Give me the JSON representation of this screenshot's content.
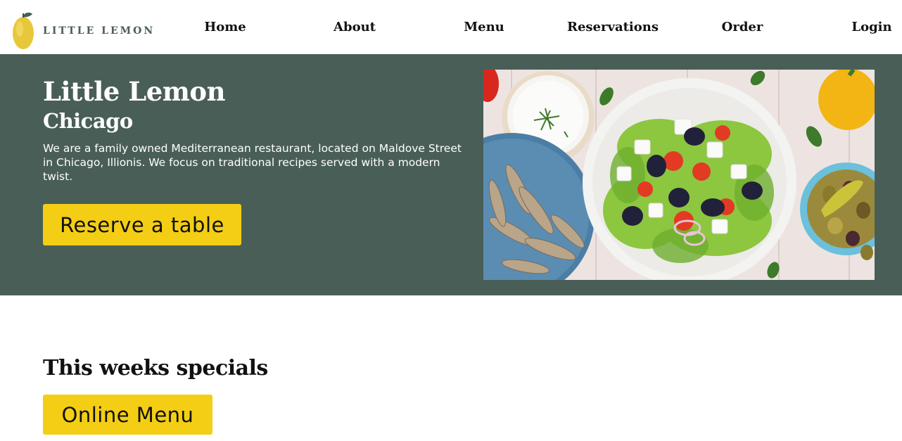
{
  "header": {
    "logo_text": "LITTLE LEMON",
    "nav": [
      {
        "label": "Home"
      },
      {
        "label": "About"
      },
      {
        "label": "Menu"
      },
      {
        "label": "Reservations"
      },
      {
        "label": "Order"
      },
      {
        "label": "Login"
      }
    ]
  },
  "hero": {
    "title": "Little Lemon",
    "subtitle": "Chicago",
    "description": "We are a family owned Mediterranean restaurant, located on Maldove Street in Chicago, Illionis. We focus on traditional recipes served with a modern twist.",
    "reserve_button": "Reserve a table",
    "image_icon": "food-photo"
  },
  "specials": {
    "title": "This weeks specials",
    "menu_button": "Online Menu"
  },
  "colors": {
    "primary_green": "#495E57",
    "primary_yellow": "#F4CE14",
    "white": "#FFFFFF"
  }
}
